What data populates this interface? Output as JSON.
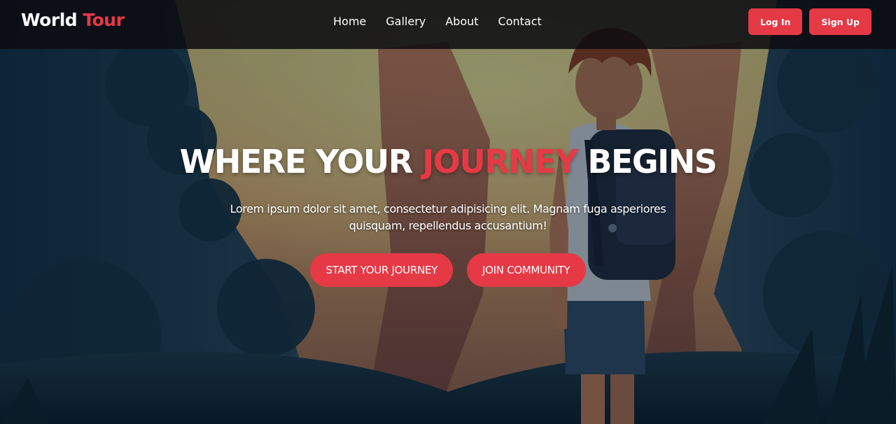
{
  "brand": {
    "name_part1": "World",
    "name_part2": "Tour"
  },
  "nav": {
    "links": [
      {
        "label": "Home"
      },
      {
        "label": "Gallery"
      },
      {
        "label": "About"
      },
      {
        "label": "Contact"
      }
    ]
  },
  "auth": {
    "login_label": "Log In",
    "signup_label": "Sign Up"
  },
  "hero": {
    "title_part1": "WHERE YOUR",
    "title_highlight": "JOURNEY",
    "title_part2": "BEGINS",
    "subtitle": "Lorem ipsum dolor sit amet, consectetur adipisicing elit. Magnam fuga asperiores quisquam, repellendus accusantium!",
    "cta_primary": "START YOUR JOURNEY",
    "cta_secondary": "JOIN COMMUNITY"
  },
  "colors": {
    "accent": "#e63946",
    "navbar_bg": "#0c0c10",
    "text": "#ffffff"
  }
}
